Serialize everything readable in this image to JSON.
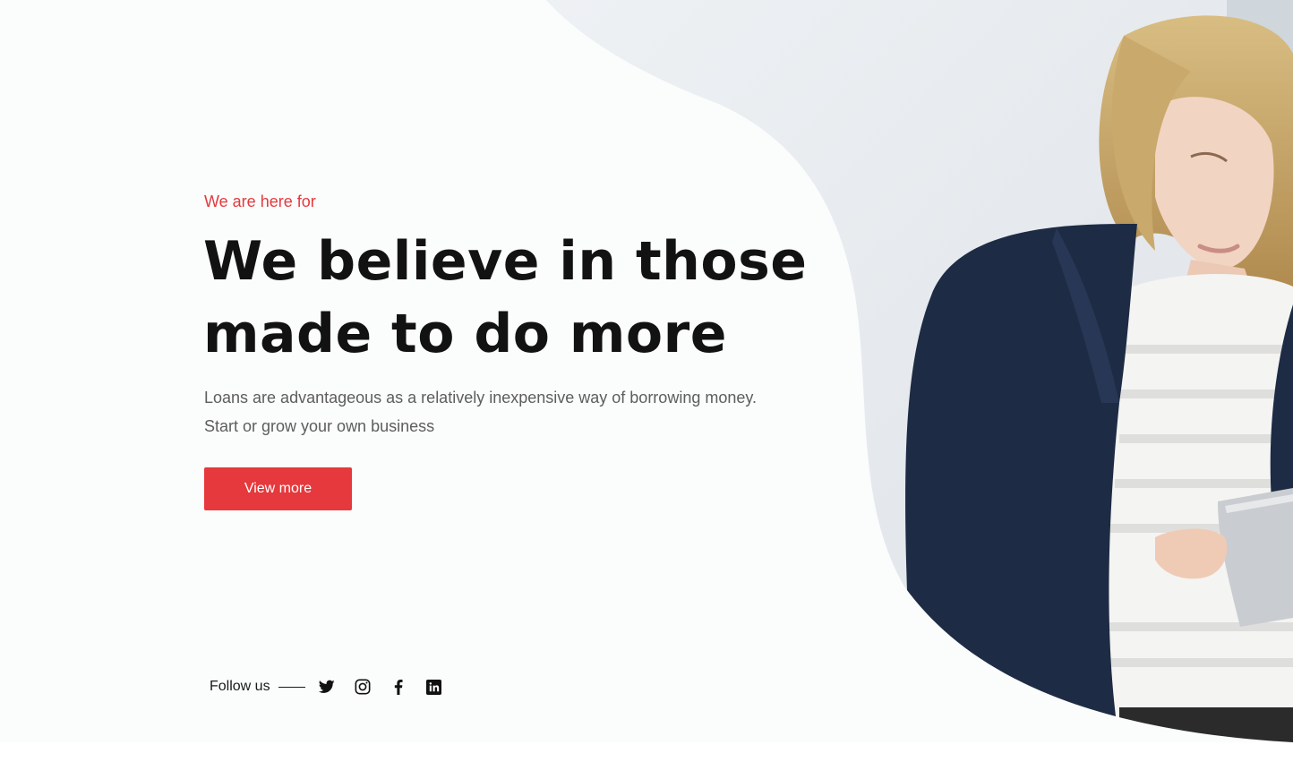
{
  "hero": {
    "eyebrow": "We are here for",
    "headline_lines": [
      "We believe in those",
      "made to do more"
    ],
    "description_lines": [
      "Loans are advantageous as a relatively inexpensive way of borrowing money.",
      "Start or grow your own business"
    ],
    "cta_label": "View more"
  },
  "social": {
    "label": "Follow us",
    "icons": [
      "twitter-icon",
      "instagram-icon",
      "facebook-icon",
      "linkedin-icon"
    ]
  },
  "colors": {
    "accent": "#e5393d",
    "heading": "#121212",
    "body_text": "#5d5d5d",
    "background": "#fbfcfc",
    "jacket": "#1e2b45",
    "hair": "#c9a96c"
  }
}
